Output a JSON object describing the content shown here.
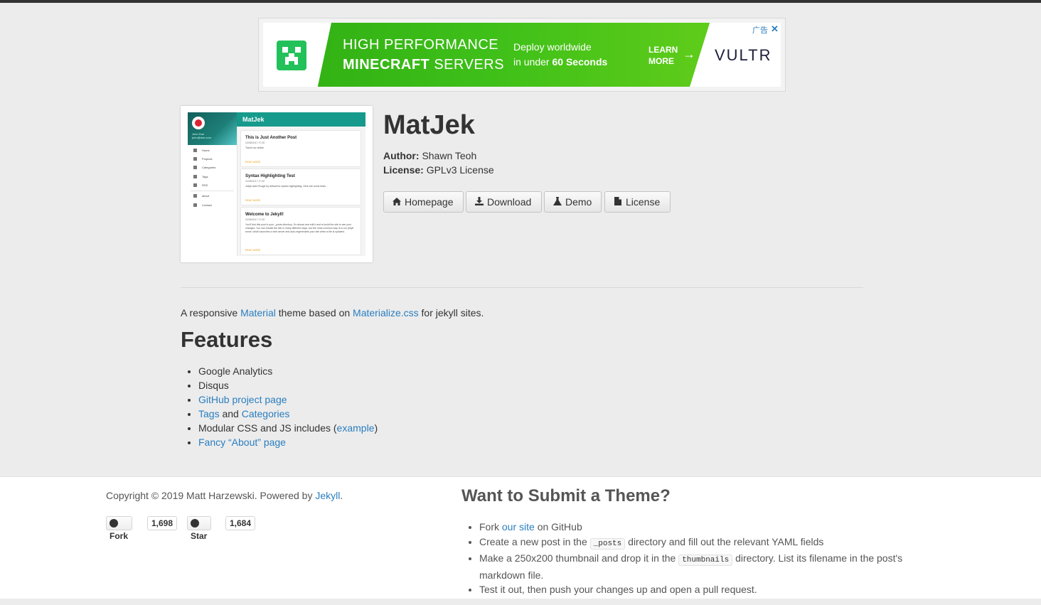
{
  "ad": {
    "line1": "HIGH PERFORMANCE",
    "line2_bold": "MINECRAFT",
    "line2_rest": " SERVERS",
    "deploy_line1": "Deploy worldwide",
    "deploy_line2_pre": "in under ",
    "deploy_line2_bold": "60 Seconds",
    "learn1": "LEARN",
    "learn2": "MORE",
    "brand": "VULTR",
    "adchoice": "广告",
    "close": "✕"
  },
  "thumbnail": {
    "header_title": "MatJek",
    "sidebar_name": "John Doe",
    "sidebar_email": "john@doe.com",
    "nav": [
      "Home",
      "Projects",
      "Categories",
      "Tags",
      "RSS",
      "about",
      "Contact"
    ],
    "posts": [
      {
        "title": "This is Just Another Post",
        "date": "24/08/2017 17:00",
        "text": "Travel our article.",
        "more": "READ MORE"
      },
      {
        "title": "Syntax Highlighting Test",
        "date": "22/08/2017 17:00",
        "text": "Jekyll uses Rouge by default for syntax highlighting. Here are some tests.",
        "more": "READ MORE"
      },
      {
        "title": "Welcome to Jekyll!",
        "date": "22/08/2017 17:00",
        "text": "You'll find this post in your _posts directory. Go ahead and edit it and re-build the site to see your changes. You can rebuild the site in many different ways, but the most common way is to run jekyll serve, which launches a web server and auto-regenerates your site when a file is updated.",
        "more": "READ MORE"
      }
    ]
  },
  "theme": {
    "title": "MatJek",
    "author_label": "Author:",
    "author": "Shawn Teoh",
    "license_label": "License:",
    "license": "GPLv3 License"
  },
  "buttons": {
    "homepage": "Homepage",
    "download": "Download",
    "demo": "Demo",
    "license": "License"
  },
  "description": {
    "pre": "A responsive ",
    "link1": "Material",
    "mid": " theme based on ",
    "link2": "Materialize.css",
    "post": " for jekyll sites."
  },
  "features": {
    "heading": "Features",
    "items": {
      "analytics": "Google Analytics",
      "disqus": "Disqus",
      "github_link": "GitHub project page",
      "tags_link": "Tags",
      "and": " and ",
      "categories_link": "Categories",
      "modular_pre": "Modular CSS and JS includes (",
      "modular_link": "example",
      "modular_post": ")",
      "about_link": "Fancy “About” page"
    }
  },
  "footer": {
    "copyright_pre": "Copyright © 2019 Matt Harzewski. Powered by ",
    "jekyll_link": "Jekyll",
    "copyright_post": ".",
    "fork_label": "Fork",
    "fork_count": "1,698",
    "star_label": "Star",
    "star_count": "1,684",
    "submit_heading": "Want to Submit a Theme?",
    "steps": {
      "s1_pre": "Fork ",
      "s1_link": "our site",
      "s1_post": " on GitHub",
      "s2_pre": "Create a new post in the ",
      "s2_code": "_posts",
      "s2_post": " directory and fill out the relevant YAML fields",
      "s3_pre": "Make a 250x200 thumbnail and drop it in the ",
      "s3_code": "thumbnails",
      "s3_post": " directory. List its filename in the post's markdown file.",
      "s4": "Test it out, then push your changes up and open a pull request."
    }
  },
  "colors": {
    "link": "#2a7ec0",
    "page_bg": "#ececec",
    "ad_green": "#3fc019",
    "thumb_teal": "#159a8c"
  },
  "icons": {
    "homepage": "home-icon",
    "download": "download-icon",
    "demo": "flask-icon",
    "license": "file-icon",
    "github": "github-octocat-icon",
    "ad_logo": "creeper-icon",
    "ad_arrow": "arrow-right-icon"
  }
}
